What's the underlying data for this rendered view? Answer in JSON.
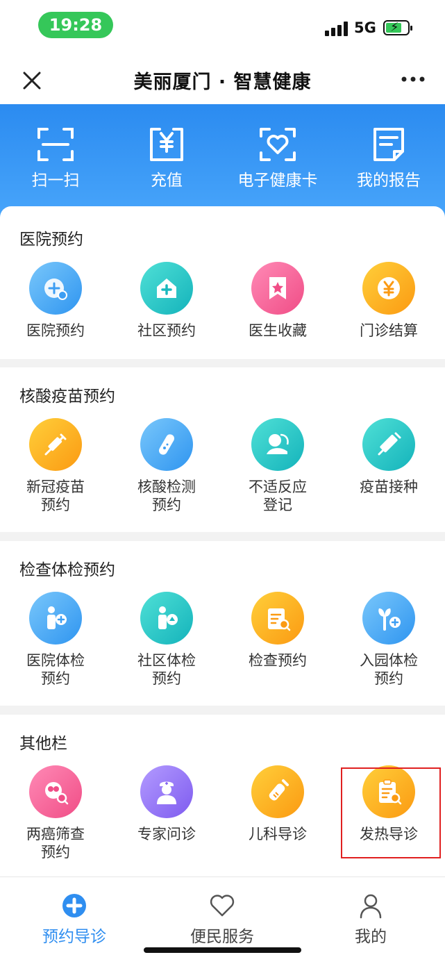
{
  "status": {
    "time": "19:28",
    "network": "5G"
  },
  "nav": {
    "title": "美丽厦门 · 智慧健康"
  },
  "quick_actions": [
    {
      "label": "扫一扫",
      "icon": "scan-icon"
    },
    {
      "label": "充值",
      "icon": "recharge-icon"
    },
    {
      "label": "电子健康卡",
      "icon": "health-card-icon"
    },
    {
      "label": "我的报告",
      "icon": "report-icon"
    }
  ],
  "sections": [
    {
      "title": "医院预约",
      "items": [
        {
          "line1": "医院预约",
          "line2": "",
          "icon": "hospital-appointment-icon",
          "color": "#4aaaf5"
        },
        {
          "line1": "社区预约",
          "line2": "",
          "icon": "community-appointment-icon",
          "color": "#22c6c4"
        },
        {
          "line1": "医生收藏",
          "line2": "",
          "icon": "doctor-favorite-icon",
          "color": "#f56a9d"
        },
        {
          "line1": "门诊结算",
          "line2": "",
          "icon": "outpatient-payment-icon",
          "color": "#fdb227"
        }
      ]
    },
    {
      "title": "核酸疫苗预约",
      "items": [
        {
          "line1": "新冠疫苗",
          "line2": "预约",
          "icon": "covid-vaccine-icon",
          "color": "#fdb227"
        },
        {
          "line1": "核酸检测",
          "line2": "预约",
          "icon": "nucleic-test-icon",
          "color": "#4aaaf5"
        },
        {
          "line1": "不适反应",
          "line2": "登记",
          "icon": "adverse-reaction-icon",
          "color": "#22c6c4"
        },
        {
          "line1": "疫苗接种",
          "line2": "",
          "icon": "vaccination-icon",
          "color": "#22c6c4"
        }
      ]
    },
    {
      "title": "检查体检预约",
      "items": [
        {
          "line1": "医院体检",
          "line2": "预约",
          "icon": "hospital-checkup-icon",
          "color": "#4aaaf5"
        },
        {
          "line1": "社区体检",
          "line2": "预约",
          "icon": "community-checkup-icon",
          "color": "#22c6c4"
        },
        {
          "line1": "检查预约",
          "line2": "",
          "icon": "exam-appointment-icon",
          "color": "#fdb227"
        },
        {
          "line1": "入园体检",
          "line2": "预约",
          "icon": "kindergarten-checkup-icon",
          "color": "#4aaaf5"
        }
      ]
    },
    {
      "title": "其他栏",
      "items": [
        {
          "line1": "两癌筛查",
          "line2": "预约",
          "icon": "cancer-screening-icon",
          "color": "#f56a9d"
        },
        {
          "line1": "专家问诊",
          "line2": "",
          "icon": "expert-consult-icon",
          "color": "#9270f7"
        },
        {
          "line1": "儿科导诊",
          "line2": "",
          "icon": "pediatric-guide-icon",
          "color": "#fdb227"
        },
        {
          "line1": "发热导诊",
          "line2": "",
          "icon": "fever-guide-icon",
          "color": "#fdb227"
        }
      ]
    }
  ],
  "tabs": [
    {
      "label": "预约导诊",
      "icon": "plus-icon",
      "active": true
    },
    {
      "label": "便民服务",
      "icon": "heart-icon",
      "active": false
    },
    {
      "label": "我的",
      "icon": "user-icon",
      "active": false
    }
  ]
}
